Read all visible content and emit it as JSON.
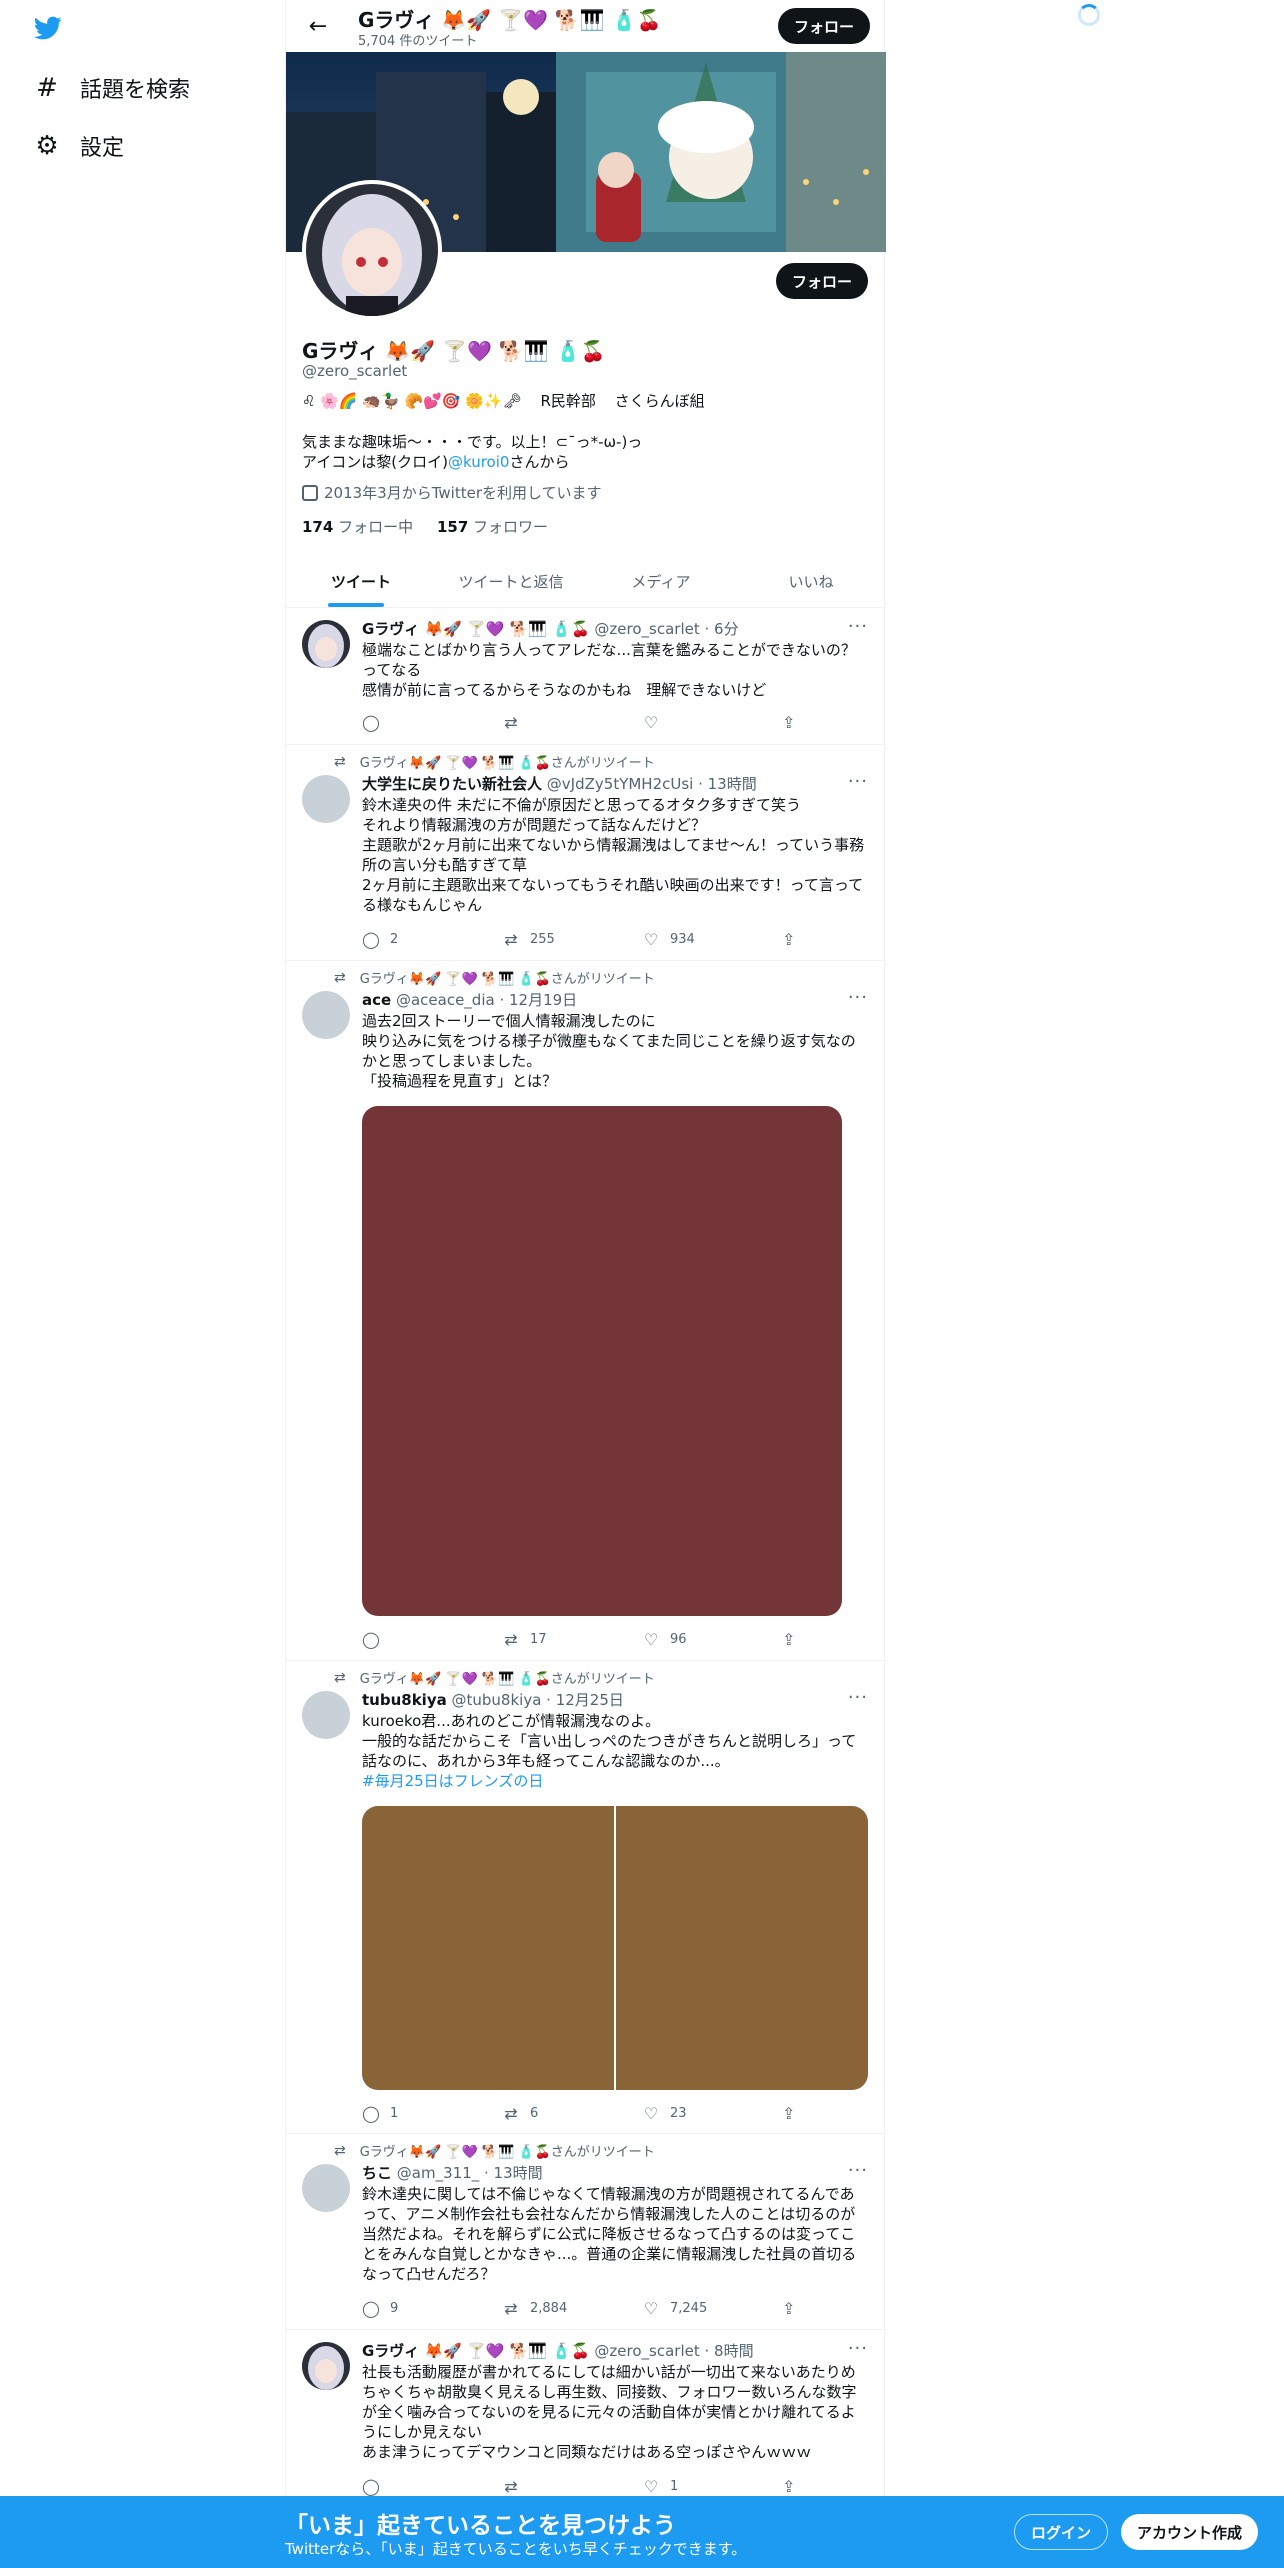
{
  "header": {
    "name": "Gラヴィ 🦊🚀 🍸💜 🐕🎹 🧴🍒",
    "tweet_count": "5,704 件のツイート",
    "follow_label": "フォロー"
  },
  "sidebar": {
    "items": [
      {
        "label": "話題を検索",
        "icon": "#"
      },
      {
        "label": "設定",
        "icon": "⚙"
      }
    ]
  },
  "profile": {
    "name": "Gラヴィ 🦊🚀 🍸💜 🐕🎹 🧴🍒",
    "handle": "@zero_scarlet",
    "meta_emoji": "♌ 🌸🌈 🦔🦆 🥐💕🎯 🌼✨🗝",
    "tag1": "R民幹部",
    "tag2": "さくらんぼ組",
    "bio_line1": "気ままな趣味垢～・・・です。以上！⊂¯っ*-ω-)っ",
    "bio_line2_prefix": "アイコンは黎(クロイ)",
    "bio_line2_link": "@kuroi0",
    "bio_line2_suffix": "さんから",
    "joined": "2013年3月からTwitterを利用しています",
    "following_count": "174",
    "following_label": "フォロー中",
    "followers_count": "157",
    "followers_label": "フォロワー",
    "follow_label": "フォロー"
  },
  "tabs": [
    "ツイート",
    "ツイートと返信",
    "メディア",
    "いいね"
  ],
  "retweet_label": "Gラヴィ🦊🚀 🍸💜 🐕🎹 🧴🍒さんがリツイート",
  "tweets": [
    {
      "name": "Gラヴィ 🦊🚀 🍸💜 🐕🎹 🧴🍒",
      "meta": "@zero_scarlet · 6分",
      "text": "極端なことばかり言う人ってアレだな...言葉を鑑みることができないの？ってなる\n感情が前に言ってるからそうなのかもね　理解できないけど",
      "replies": "",
      "retweets": "",
      "likes": ""
    },
    {
      "name": "大学生に戻りたい新社会人",
      "meta": "@vJdZy5tYMH2cUsi · 13時間",
      "text": "鈴木達央の件 未だに不倫が原因だと思ってるオタク多すぎて笑う\nそれより情報漏洩の方が問題だって話なんだけど？\n主題歌が2ヶ月前に出来てないから情報漏洩はしてませ〜ん！っていう事務所の言い分も酷すぎて草\n2ヶ月前に主題歌出来てないってもうそれ酷い映画の出来です！って言ってる様なもんじゃん",
      "replies": "2",
      "retweets": "255",
      "likes": "934"
    },
    {
      "name": "ace",
      "meta": "@aceace_dia · 12月19日",
      "text": "過去2回ストーリーで個人情報漏洩したのに\n映り込みに気をつける様子が微塵もなくてまた同じことを繰り返す気なのかと思ってしまいました。\n「投稿過程を見直す」とは？",
      "replies": "",
      "retweets": "17",
      "likes": "96"
    },
    {
      "name": "tubu8kiya",
      "meta": "@tubu8kiya · 12月25日",
      "text": "kuroeko君...あれのどこが情報漏洩なのよ。\n一般的な話だからこそ「言い出しっぺのたつきがきちんと説明しろ」って話なのに、あれから3年も経ってこんな認識なのか...。",
      "hashtag": "#毎月25日はフレンズの日",
      "replies": "1",
      "retweets": "6",
      "likes": "23"
    },
    {
      "name": "ちこ",
      "meta": "@am_311_ · 13時間",
      "text": "鈴木達央に関しては不倫じゃなくて情報漏洩の方が問題視されてるんであって、アニメ制作会社も会社なんだから情報漏洩した人のことは切るのが当然だよね。それを解らずに公式に降板させるなって凸するのは変ってことをみんな自覚しとかなきゃ...。普通の企業に情報漏洩した社員の首切るなって凸せんだろ？",
      "replies": "9",
      "retweets": "2,884",
      "likes": "7,245"
    },
    {
      "name": "Gラヴィ 🦊🚀 🍸💜 🐕🎹 🧴🍒",
      "meta": "@zero_scarlet · 8時間",
      "text": "社長も活動履歴が書かれてるにしては細かい話が一切出て来ないあたりめちゃくちゃ胡散臭く見えるし再生数、同接数、フォロワー数いろんな数字が全く噛み合ってないのを見るに元々の活動自体が実情とかけ離れてるようにしか見えない\nあま津うにってデマウンコと同類なだけはある空っぽさやんｗｗｗ",
      "replies": "",
      "retweets": "",
      "likes": "1"
    }
  ],
  "bottom_bar": {
    "title": "「いま」起きていることを見つけよう",
    "subtitle": "Twitterなら、「いま」起きていることをいち早くチェックできます。",
    "login": "ログイン",
    "signup": "アカウント作成"
  },
  "colors": {
    "accent": "#1d9bf0",
    "media_ace": "#733538",
    "media_tubu": "#8a6439"
  }
}
